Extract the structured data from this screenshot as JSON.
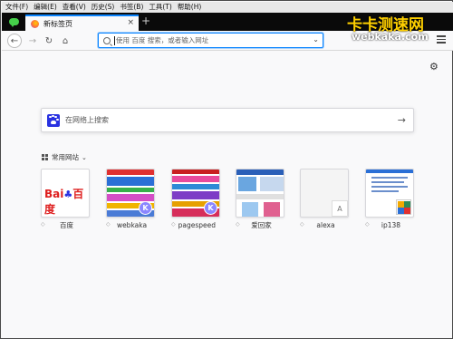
{
  "menu": [
    "文件(F)",
    "编辑(E)",
    "查看(V)",
    "历史(S)",
    "书签(B)",
    "工具(T)",
    "帮助(H)"
  ],
  "tab": {
    "title": "新标签页",
    "close": "×",
    "new": "+"
  },
  "toolbar": {
    "back": "←",
    "forward": "→",
    "reload": "↻",
    "home": "⌂",
    "url_placeholder": "使用 百度 搜索，或者输入网址",
    "url_dropdown": "⌄"
  },
  "watermark": {
    "cn": "卡卡测速网",
    "en": "webkaka.com"
  },
  "content": {
    "settings": "⚙",
    "search_placeholder": "在网络上搜索",
    "search_arrow": "→",
    "top_sites_title": "常用网站",
    "top_sites_chevron": "⌄"
  },
  "tiles": [
    {
      "label": "百度",
      "logo": "Bai度百度"
    },
    {
      "label": "webkaka",
      "badge": "K"
    },
    {
      "label": "pagespeed",
      "badge": "K"
    },
    {
      "label": "爱回家"
    },
    {
      "label": "alexa",
      "badge": "A"
    },
    {
      "label": "ip138"
    }
  ],
  "colors": {
    "accent": "#0a84ff",
    "baidu_red": "#de1e1e",
    "baidu_blue": "#2932e1",
    "badge_purple": "#8b86ff"
  }
}
